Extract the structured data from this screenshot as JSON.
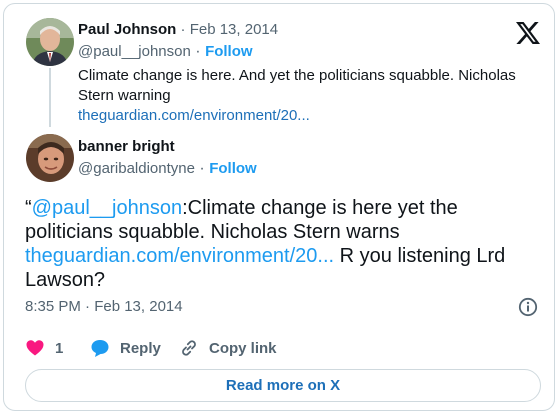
{
  "quoted": {
    "author_name": "Paul Johnson",
    "separator": "·",
    "date": "Feb 13, 2014",
    "handle": "@paul__johnson",
    "follow_label": "Follow",
    "text": "Climate change is here. And yet the politicians squabble. Nicholas Stern warning",
    "link": "theguardian.com/environment/20..."
  },
  "tweet": {
    "author_name": "banner bright",
    "handle": "@garibaldiontyne",
    "separator": "·",
    "follow_label": "Follow",
    "open_quote": "“",
    "mention": "@paul__johnson",
    "text_part1": ":Climate change is here yet the politicians squabble. Nicholas Stern warns ",
    "link": "theguardian.com/environment/20...",
    "text_part2": " R you listening Lrd Lawson?",
    "timestamp": "8:35 PM · Feb 13, 2014"
  },
  "actions": {
    "like_count": "1",
    "reply_label": "Reply",
    "copy_label": "Copy link"
  },
  "read_more_label": "Read more on X",
  "icons": {
    "logo": "x-logo-icon",
    "info": "info-icon",
    "like": "heart-icon",
    "reply": "speech-bubble-icon",
    "copy": "chain-link-icon"
  },
  "colors": {
    "accent": "#1d9bf0",
    "link_dark": "#1d6fb8",
    "like": "#f91880",
    "muted": "#536471",
    "border": "#cfd9de"
  }
}
